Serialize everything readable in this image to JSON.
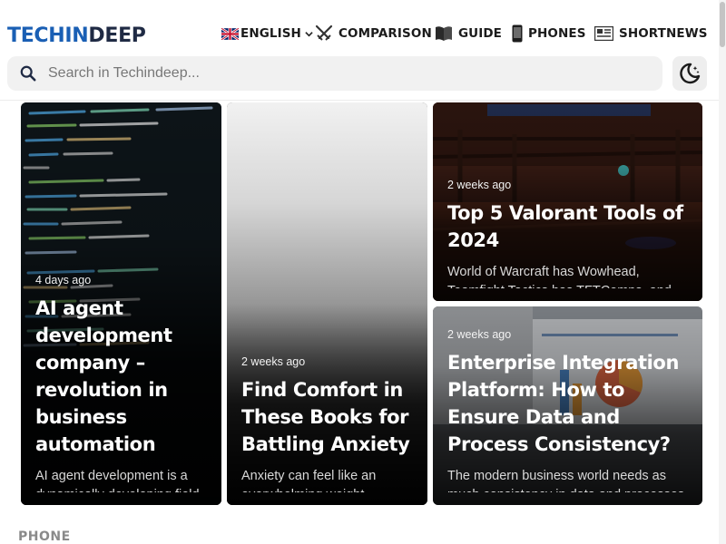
{
  "site": {
    "logo_part1": "TECHIN",
    "logo_part2": "DEEP",
    "brand_color": "#1a5fb4"
  },
  "nav": {
    "language": "ENGLISH",
    "items": [
      {
        "label": "COMPARISON",
        "icon": "swords-icon"
      },
      {
        "label": "GUIDE",
        "icon": "book-icon"
      },
      {
        "label": "PHONES",
        "icon": "phone-icon"
      },
      {
        "label": "SHORTNEWS",
        "icon": "newspaper-icon"
      }
    ]
  },
  "search": {
    "placeholder": "Search in Techindeep...",
    "value": ""
  },
  "theme_toggle_icon": "moon-stars-icon",
  "articles": [
    {
      "date": "4 days ago",
      "title": "AI agent development company – revolution in business automation",
      "excerpt": "AI agent development is a dynamically developing field of"
    },
    {
      "date": "2 weeks ago",
      "title": "Find Comfort in These Books for Battling Anxiety",
      "excerpt": "Anxiety can feel like an overwhelming weight pressing"
    },
    {
      "date": "2 weeks ago",
      "title": "Top 5 Valorant Tools of 2024",
      "excerpt": "World of Warcraft has Wowhead, Teamfight Tactics has TFTComps, and"
    },
    {
      "date": "2 weeks ago",
      "title": "Enterprise Integration Platform: How to Ensure Data and Process Consistency?",
      "excerpt": "The modern business world needs as much consistency in data and processes"
    }
  ],
  "section_label": "PHONE"
}
